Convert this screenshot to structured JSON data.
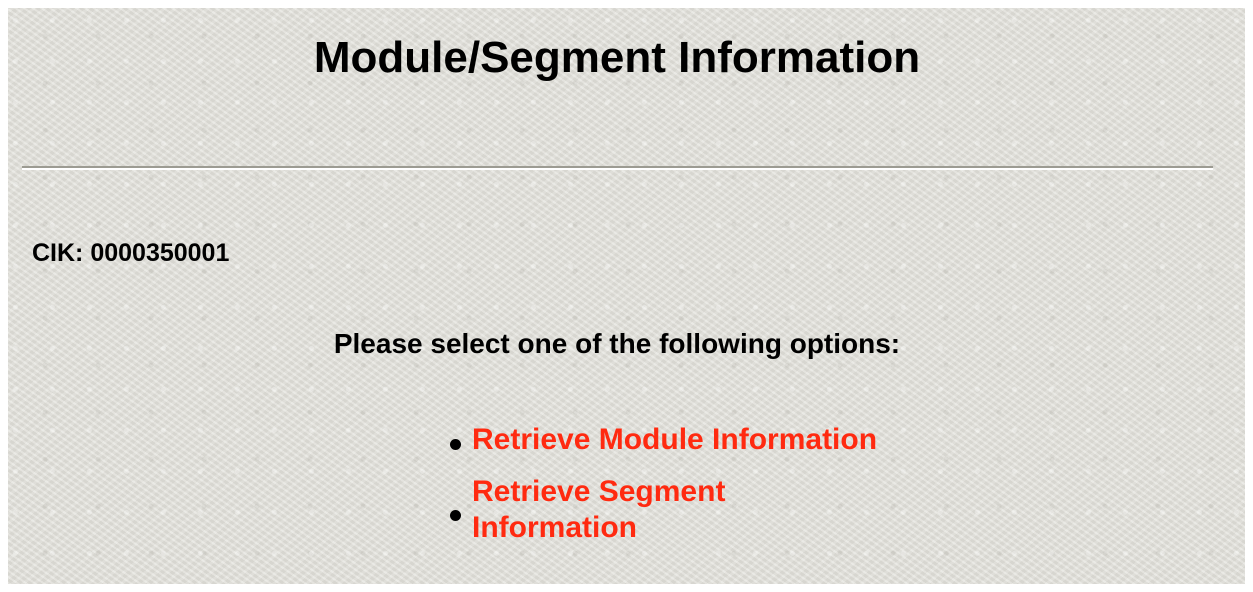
{
  "page": {
    "title": "Module/Segment Information",
    "cik_label": "CIK: 0000350001",
    "prompt": "Please select one of the following options:",
    "options": [
      {
        "label": "Retrieve Module Information"
      },
      {
        "label": "Retrieve Segment Information"
      }
    ]
  },
  "colors": {
    "background": "#e3e2dc",
    "link": "#ff2a10",
    "text": "#000000"
  }
}
